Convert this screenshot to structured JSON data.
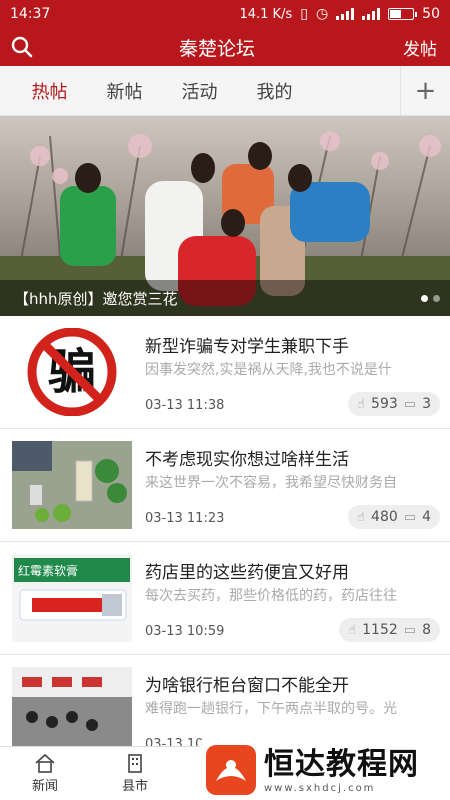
{
  "status": {
    "time": "14:37",
    "speed": "14.1 K/s",
    "battery": "50"
  },
  "header": {
    "title": "秦楚论坛",
    "post_label": "发帖",
    "search_icon": "search-icon"
  },
  "tabs": [
    {
      "label": "热帖",
      "active": true
    },
    {
      "label": "新帖",
      "active": false
    },
    {
      "label": "活动",
      "active": false
    },
    {
      "label": "我的",
      "active": false
    }
  ],
  "tabs_plus": "+",
  "banner": {
    "caption": "【hhh原创】邀您赏三花",
    "active_dot": 1,
    "dot_count": 2
  },
  "posts": [
    {
      "title": "新型诈骗专对学生兼职下手",
      "summary": "因事发突然,实是祸从天降,我也不说是什",
      "time": "03-13 11:38",
      "views": "593",
      "comments": "3",
      "thumb_text": "骗"
    },
    {
      "title": "不考虑现实你想过啥样生活",
      "summary": "来这世界一次不容易，我希望尽快财务自",
      "time": "03-13 11:23",
      "views": "480",
      "comments": "4"
    },
    {
      "title": "药店里的这些药便宜又好用",
      "summary": "每次去买药，那些价格低的药，药店往往",
      "time": "03-13 10:59",
      "views": "1152",
      "comments": "8",
      "thumb_text": "红霉素软膏"
    },
    {
      "title": "为啥银行柜台窗口不能全开",
      "summary": "难得跑一趟银行，下午两点半取的号。光",
      "time": "03-13 10",
      "views": "",
      "comments": ""
    }
  ],
  "tabbar": [
    {
      "label": "新闻",
      "icon": "home-icon"
    },
    {
      "label": "县市",
      "icon": "building-icon"
    }
  ],
  "watermark": {
    "text": "恒达教程网",
    "url": "www.sxhdcj.com"
  },
  "colors": {
    "brand": "#b8181c",
    "active_tab": "#b8181c"
  }
}
